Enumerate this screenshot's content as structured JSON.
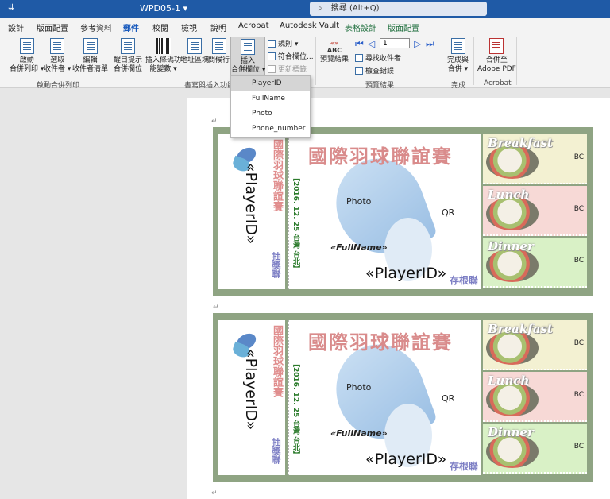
{
  "titlebar": {
    "quick_access": "⇊",
    "doc_title": "WPD05-1 ▾",
    "search_placeholder": "搜尋 (Alt+Q)"
  },
  "tabs": [
    "設計",
    "版面配置",
    "參考資料",
    "郵件",
    "校閱",
    "檢視",
    "說明",
    "Acrobat",
    "Autodesk Vault",
    "表格設計",
    "版面配置"
  ],
  "active_tab": "郵件",
  "ribbon": {
    "groups": {
      "start": "啟動合併列印",
      "write_insert": "書寫與插入功能變數",
      "preview": "預覽結果",
      "finish": "完成",
      "acrobat": "Acrobat"
    },
    "buttons": {
      "start_merge": [
        "啟動",
        "合併列印 ▾"
      ],
      "select_recipients": [
        "選取",
        "收件者 ▾"
      ],
      "edit_list": [
        "編輯",
        "收件者清單"
      ],
      "highlight": [
        "醒目提示",
        "合併欄位"
      ],
      "insert_barcode": [
        "插入條碼功",
        "能變數 ▾"
      ],
      "address_block": [
        "地址區塊"
      ],
      "greeting_line": [
        "問候行"
      ],
      "insert_field": [
        "插入",
        "合併欄位 ▾"
      ],
      "rules": "規則 ▾",
      "match_fields": "符合欄位...",
      "update_labels": "更新標籤",
      "preview_results": [
        "預覽結果"
      ],
      "record_number": "1",
      "find_recipient": "尋找收件者",
      "check_errors": "檢查錯誤",
      "finish_merge": [
        "完成與",
        "合併 ▾"
      ],
      "merge_pdf": [
        "合併至",
        "Adobe PDF"
      ]
    }
  },
  "dropdown": {
    "items": [
      "PlayerID",
      "FullName",
      "Photo",
      "Phone_number"
    ],
    "highlighted": "PlayerID"
  },
  "ticket": {
    "title": "國際羽球聯誼賽",
    "stub_title": "國際羽球聯誼賽",
    "player_id_field": "«PlayerID»",
    "full_name_field": "«FullName»",
    "photo_field": "Photo",
    "qr_field": "QR",
    "date_place": "【2016. 12. 25 台灣 台北】",
    "lottery_stub": "抽獎聯",
    "keep_stub": "存根聯",
    "meals": [
      "Breakfast",
      "Lunch",
      "Dinner"
    ],
    "barcode_field": "BC"
  },
  "colors": {
    "titlebar": "#1f5aa6",
    "accent": "#185abd",
    "ticket_border": "#8fa483",
    "title_pink": "#d98b8b",
    "stub_purple": "#7c7ec4"
  }
}
